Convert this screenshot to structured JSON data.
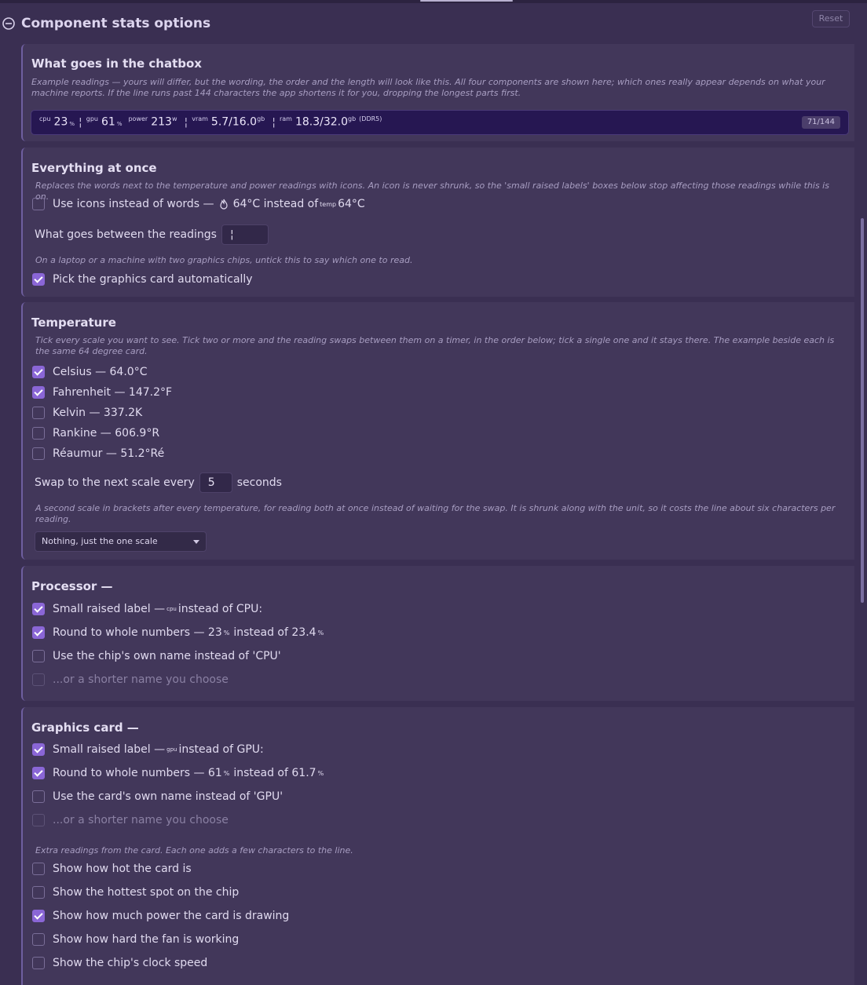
{
  "header": {
    "title": "Component stats options",
    "reset_label": "Reset"
  },
  "chatbox": {
    "title": "What goes in the chatbox",
    "note": "Example readings — yours will differ, but the wording, the order and the length will look like this. All four components are shown here; which ones really appear depends on what your machine reports. If the line runs past 144 characters the app shortens it for you, dropping the longest parts first.",
    "preview": {
      "cpu_label": "cpu",
      "cpu_value": "23",
      "cpu_unit": "%",
      "gpu_label": "gpu",
      "gpu_value": "61",
      "gpu_unit": "%",
      "power_label": "power",
      "power_value": "213",
      "power_unit": "w",
      "vram_label": "vram",
      "vram_value": "5.7/16.0",
      "vram_unit": "gb",
      "ram_label": "ram",
      "ram_value": "18.3/32.0",
      "ram_unit": "gb",
      "ram_extra": "(DDR5)",
      "separator": "¦"
    },
    "counter": "71/144"
  },
  "everything": {
    "title": "Everything at once",
    "note1": "Replaces the words next to the temperature and power readings with icons. An icon is never shrunk, so the 'small raised labels' boxes below stop affecting those readings while this is on.",
    "icons_label_a": "Use icons instead of words —",
    "icons_label_b": "64°C instead of",
    "icons_label_sup": "temp",
    "icons_label_c": "64°C",
    "icons_checked": false,
    "separator_label": "What goes between the readings",
    "separator_value": "¦",
    "note2": "On a laptop or a machine with two graphics chips, untick this to say which one to read.",
    "auto_gpu_label": "Pick the graphics card automatically",
    "auto_gpu_checked": true
  },
  "temperature": {
    "title": "Temperature",
    "note": "Tick every scale you want to see. Tick two or more and the reading swaps between them on a timer, in the order below; tick a single one and it stays there. The example beside each is the same 64 degree card.",
    "scales": [
      {
        "label": "Celsius — 64.0°C",
        "checked": true
      },
      {
        "label": "Fahrenheit — 147.2°F",
        "checked": true
      },
      {
        "label": "Kelvin — 337.2K",
        "checked": false
      },
      {
        "label": "Rankine — 606.9°R",
        "checked": false
      },
      {
        "label": "Réaumur — 51.2°Ré",
        "checked": false
      }
    ],
    "swap_label": "Swap to the next scale every",
    "swap_value": "5",
    "swap_unit": "seconds",
    "note2": "A second scale in brackets after every temperature, for reading both at once instead of waiting for the swap. It is shrunk along with the unit, so it costs the line about six characters per reading.",
    "second_scale_selected": "Nothing, just the one scale"
  },
  "processor": {
    "title": "Processor —",
    "raised_a": "Small raised label —",
    "raised_sup": "cpu",
    "raised_b": "instead of CPU:",
    "round_a": "Round to whole numbers — 23",
    "round_unit": "%",
    "round_b": "instead of 23.4",
    "round_unit2": "%",
    "chipname_label": "Use the chip's own name instead of 'CPU'",
    "shorter_label": "...or a shorter name you choose"
  },
  "graphics": {
    "title": "Graphics card —",
    "raised_a": "Small raised label —",
    "raised_sup": "gpu",
    "raised_b": "instead of GPU:",
    "round_a": "Round to whole numbers — 61",
    "round_unit": "%",
    "round_b": "instead of 61.7",
    "round_unit2": "%",
    "cardname_label": "Use the card's own name instead of 'GPU'",
    "shorter_label": "...or a shorter name you choose",
    "extras_note": "Extra readings from the card. Each one adds a few characters to the line.",
    "extras": [
      {
        "label": "Show how hot the card is",
        "checked": false
      },
      {
        "label": "Show the hottest spot on the chip",
        "checked": false
      },
      {
        "label": "Show how much power the card is drawing",
        "checked": true
      },
      {
        "label": "Show how hard the fan is working",
        "checked": false
      },
      {
        "label": "Show the chip's clock speed",
        "checked": false
      }
    ]
  }
}
